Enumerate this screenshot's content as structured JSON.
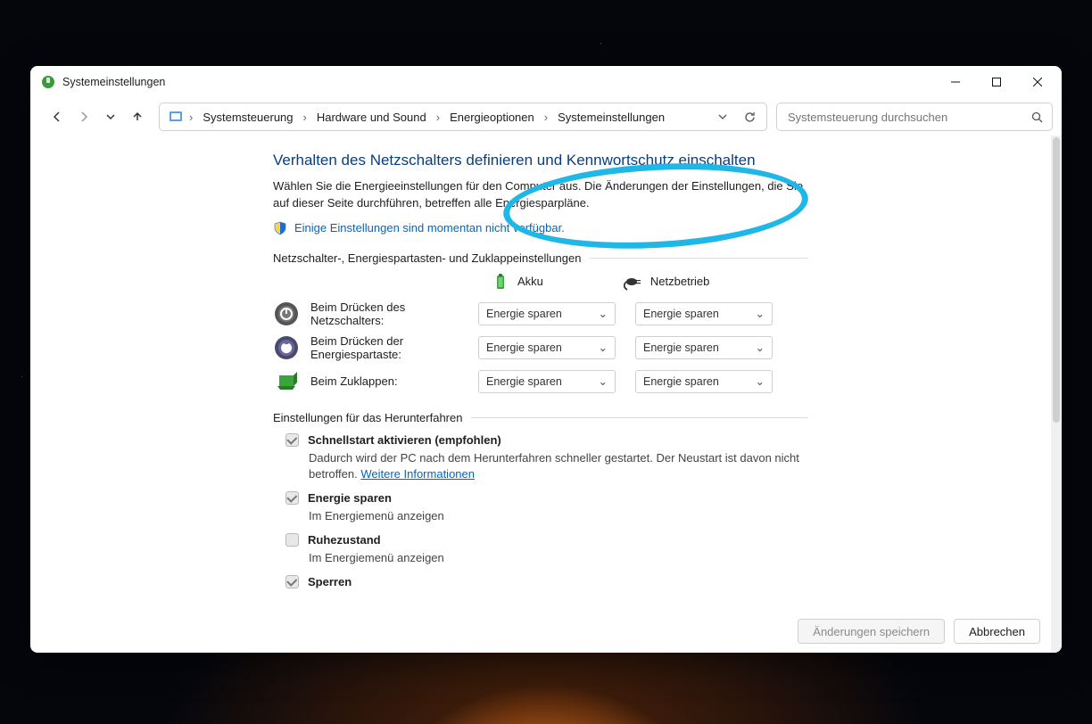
{
  "window": {
    "title": "Systemeinstellungen"
  },
  "breadcrumbs": [
    "Systemsteuerung",
    "Hardware und Sound",
    "Energieoptionen",
    "Systemeinstellungen"
  ],
  "search": {
    "placeholder": "Systemsteuerung durchsuchen"
  },
  "page": {
    "heading": "Verhalten des Netzschalters definieren und Kennwortschutz einschalten",
    "intro": "Wählen Sie die Energieeinstellungen für den Computer aus. Die Änderungen der Einstellungen, die Sie auf dieser Seite durchführen, betreffen alle Energiesparpläne.",
    "admin_link": "Einige Einstellungen sind momentan nicht verfügbar."
  },
  "section1": {
    "title": "Netzschalter-, Energiespartasten- und Zuklappeinstellungen",
    "col_battery": "Akku",
    "col_plugged": "Netzbetrieb",
    "rows": [
      {
        "label": "Beim Drücken des Netzschalters:",
        "battery": "Energie sparen",
        "plugged": "Energie sparen"
      },
      {
        "label": "Beim Drücken der Energiespartaste:",
        "battery": "Energie sparen",
        "plugged": "Energie sparen"
      },
      {
        "label": "Beim Zuklappen:",
        "battery": "Energie sparen",
        "plugged": "Energie sparen"
      }
    ]
  },
  "section2": {
    "title": "Einstellungen für das Herunterfahren",
    "items": [
      {
        "label": "Schnellstart aktivieren (empfohlen)",
        "checked": true,
        "desc": "Dadurch wird der PC nach dem Herunterfahren schneller gestartet. Der Neustart ist davon nicht betroffen.",
        "link": "Weitere Informationen"
      },
      {
        "label": "Energie sparen",
        "checked": true,
        "desc": "Im Energiemenü anzeigen"
      },
      {
        "label": "Ruhezustand",
        "checked": false,
        "desc": "Im Energiemenü anzeigen"
      },
      {
        "label": "Sperren",
        "checked": true,
        "desc": ""
      }
    ]
  },
  "footer": {
    "save": "Änderungen speichern",
    "cancel": "Abbrechen"
  }
}
